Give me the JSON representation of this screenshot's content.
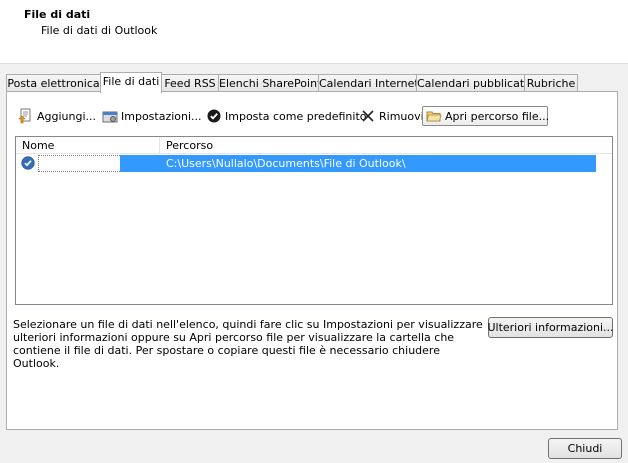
{
  "header": {
    "title": "File di dati",
    "subtitle": "File di dati di Outlook"
  },
  "tabs": [
    {
      "label": "Posta elettronica"
    },
    {
      "label": "File di dati"
    },
    {
      "label": "Feed RSS"
    },
    {
      "label": "Elenchi SharePoint"
    },
    {
      "label": "Calendari Internet"
    },
    {
      "label": "Calendari pubblicati"
    },
    {
      "label": "Rubriche"
    }
  ],
  "toolbar": {
    "add": "Aggiungi...",
    "settings": "Impostazioni...",
    "set_default": "Imposta come predefinito",
    "remove": "Rimuovi",
    "open_location": "Apri percorso file..."
  },
  "list": {
    "columns": {
      "name": "Nome",
      "path": "Percorso"
    },
    "rows": [
      {
        "name": "",
        "path": "C:\\Users\\Nullalo\\Documents\\File di Outlook\\"
      }
    ]
  },
  "description": "Selezionare un file di dati nell'elenco, quindi fare clic su Impostazioni per visualizzare ulteriori informazioni oppure su Apri percorso file per visualizzare la cartella che contiene il file di dati. Per spostare o copiare questi file è necessario chiudere Outlook.",
  "buttons": {
    "more_info": "Ulteriori informazioni...",
    "close": "Chiudi"
  },
  "colors": {
    "selection": "#3399ff",
    "panel_border": "#adadad"
  }
}
